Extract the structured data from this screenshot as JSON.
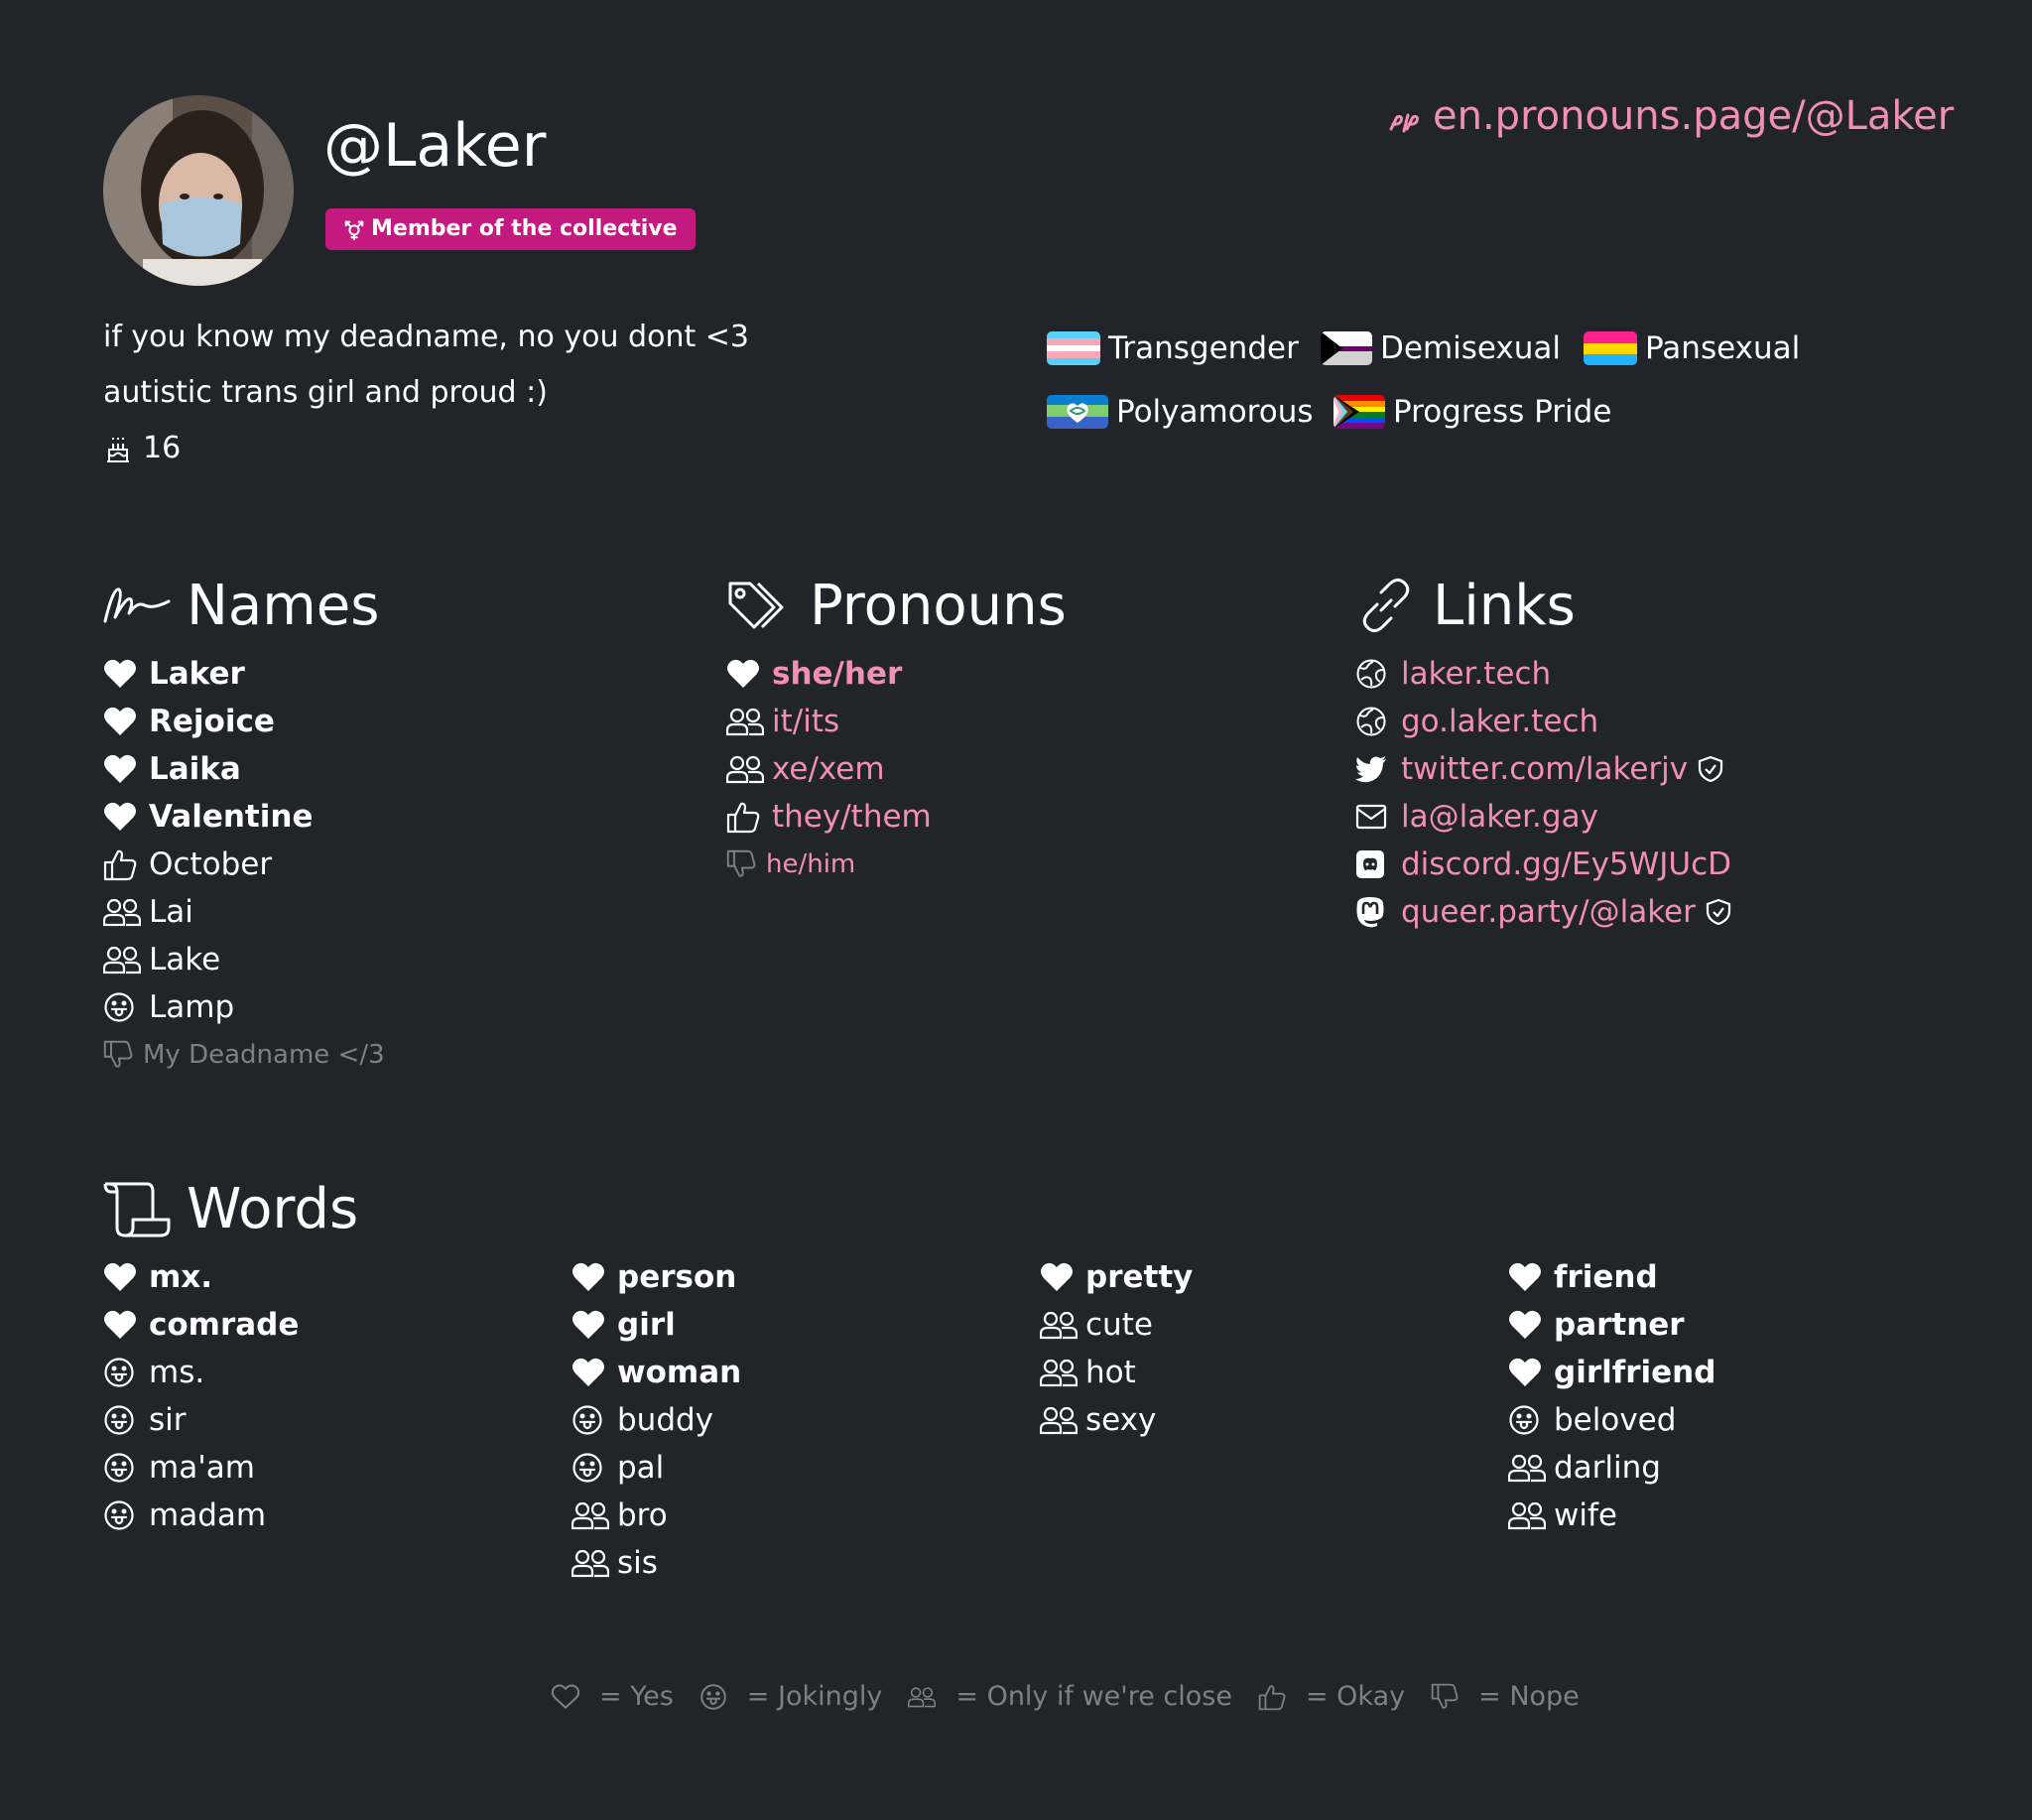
{
  "header": {
    "username": "@Laker",
    "badge": "Member of the collective",
    "profile_url": "en.pronouns.page/@Laker"
  },
  "description": {
    "lines": [
      "if you know my deadname, no you dont <3",
      "autistic trans girl and proud :)"
    ],
    "age": "16"
  },
  "flags": [
    {
      "label": "Transgender",
      "icon": "transgender-flag"
    },
    {
      "label": "Demisexual",
      "icon": "demisexual-flag"
    },
    {
      "label": "Pansexual",
      "icon": "pansexual-flag"
    },
    {
      "label": "Polyamorous",
      "icon": "polyamorous-flag"
    },
    {
      "label": "Progress Pride",
      "icon": "progress-pride-flag"
    }
  ],
  "sections": {
    "names": {
      "title": "Names",
      "items": [
        {
          "label": "Laker",
          "opinion": "yes"
        },
        {
          "label": "Rejoice",
          "opinion": "yes"
        },
        {
          "label": "Laika",
          "opinion": "yes"
        },
        {
          "label": "Valentine",
          "opinion": "yes"
        },
        {
          "label": "October",
          "opinion": "okay"
        },
        {
          "label": "Lai",
          "opinion": "close"
        },
        {
          "label": "Lake",
          "opinion": "close"
        },
        {
          "label": "Lamp",
          "opinion": "jokingly"
        },
        {
          "label": "My Deadname </3",
          "opinion": "nope"
        }
      ]
    },
    "pronouns": {
      "title": "Pronouns",
      "items": [
        {
          "label": "she/her",
          "opinion": "yes"
        },
        {
          "label": "it/its",
          "opinion": "close"
        },
        {
          "label": "xe/xem",
          "opinion": "close"
        },
        {
          "label": "they/them",
          "opinion": "okay"
        },
        {
          "label": "he/him",
          "opinion": "nope"
        }
      ]
    },
    "links": {
      "title": "Links",
      "items": [
        {
          "label": "laker.tech",
          "icon": "globe-icon"
        },
        {
          "label": "go.laker.tech",
          "icon": "globe-icon"
        },
        {
          "label": "twitter.com/lakerjv",
          "icon": "twitter-icon",
          "verified": true
        },
        {
          "label": "la@laker.gay",
          "icon": "envelope-icon"
        },
        {
          "label": "discord.gg/Ey5WJUcD",
          "icon": "discord-icon"
        },
        {
          "label": "queer.party/@laker",
          "icon": "mastodon-icon",
          "verified": true
        }
      ]
    },
    "words": {
      "title": "Words",
      "columns": [
        [
          {
            "label": "mx.",
            "opinion": "yes"
          },
          {
            "label": "comrade",
            "opinion": "yes"
          },
          {
            "label": "ms.",
            "opinion": "jokingly"
          },
          {
            "label": "sir",
            "opinion": "jokingly"
          },
          {
            "label": "ma'am",
            "opinion": "jokingly"
          },
          {
            "label": "madam",
            "opinion": "jokingly"
          }
        ],
        [
          {
            "label": "person",
            "opinion": "yes"
          },
          {
            "label": "girl",
            "opinion": "yes"
          },
          {
            "label": "woman",
            "opinion": "yes"
          },
          {
            "label": "buddy",
            "opinion": "jokingly"
          },
          {
            "label": "pal",
            "opinion": "jokingly"
          },
          {
            "label": "bro",
            "opinion": "close"
          },
          {
            "label": "sis",
            "opinion": "close"
          }
        ],
        [
          {
            "label": "pretty",
            "opinion": "yes"
          },
          {
            "label": "cute",
            "opinion": "close"
          },
          {
            "label": "hot",
            "opinion": "close"
          },
          {
            "label": "sexy",
            "opinion": "close"
          }
        ],
        [
          {
            "label": "friend",
            "opinion": "yes"
          },
          {
            "label": "partner",
            "opinion": "yes"
          },
          {
            "label": "girlfriend",
            "opinion": "yes"
          },
          {
            "label": "beloved",
            "opinion": "jokingly"
          },
          {
            "label": "darling",
            "opinion": "close"
          },
          {
            "label": "wife",
            "opinion": "close"
          }
        ]
      ]
    }
  },
  "legend": [
    {
      "label": "= Yes",
      "opinion": "yes"
    },
    {
      "label": "= Jokingly",
      "opinion": "jokingly"
    },
    {
      "label": "= Only if we're close",
      "opinion": "close"
    },
    {
      "label": "= Okay",
      "opinion": "okay"
    },
    {
      "label": "= Nope",
      "opinion": "nope"
    }
  ],
  "colors": {
    "background": "#212529",
    "accent_pink": "#f18fb6",
    "badge_bg": "#c4197f",
    "muted": "#7d8186"
  }
}
